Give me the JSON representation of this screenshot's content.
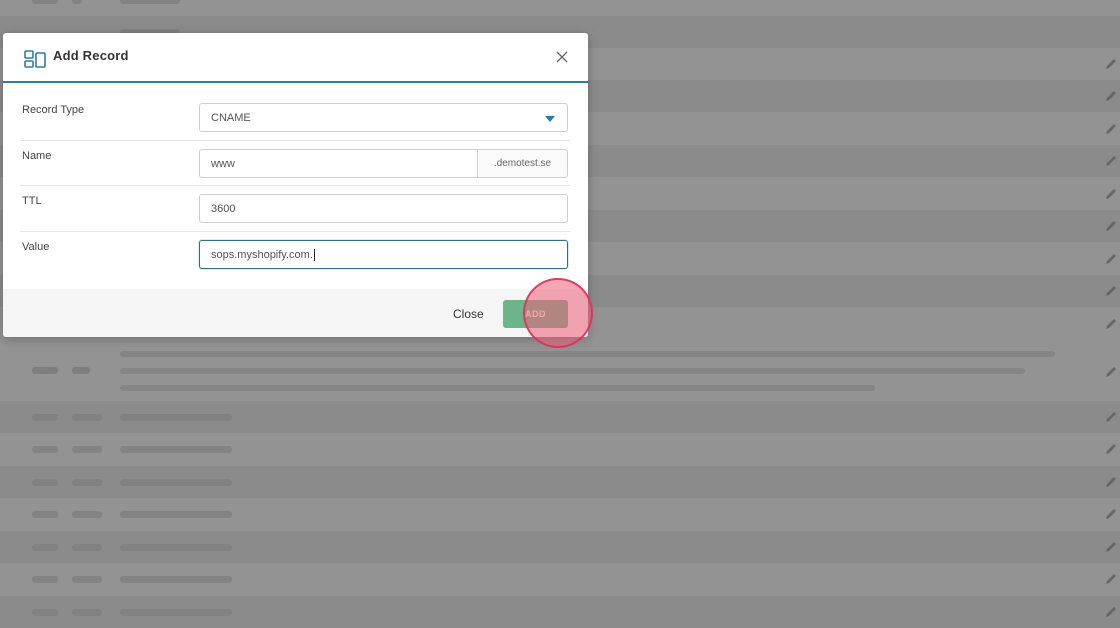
{
  "modal": {
    "title": "Add Record",
    "header_icon": "dns-records-icon",
    "close_icon": "close-icon",
    "fields": {
      "record_type": {
        "label": "Record Type",
        "value": "CNAME"
      },
      "name": {
        "label": "Name",
        "value": "www",
        "suffix": ".demotest.se"
      },
      "ttl": {
        "label": "TTL",
        "value": "3600"
      },
      "value": {
        "label": "Value",
        "value": "sops.myshopify.com."
      }
    },
    "footer": {
      "close_label": "Close",
      "add_label": "ADD"
    }
  },
  "colors": {
    "accent": "#2f7d96",
    "add_button": "#6cb58b",
    "click_indicator": "#ec5c78"
  }
}
